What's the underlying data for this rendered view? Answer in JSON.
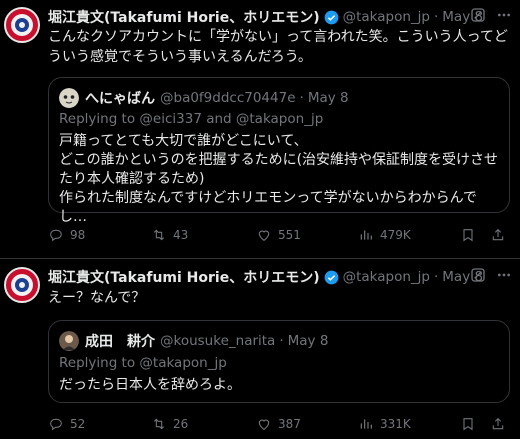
{
  "tweets": [
    {
      "name": "堀江貴文(Takafumi Horie、ホリエモン)",
      "handle": "@takapon_jp",
      "date": "May 8",
      "text": "こんなクソアカウントに「学がない」って言われた笑。こういう人ってどういう感覚でそういう事いえるんだろう。",
      "quote": {
        "name": "へにゃばん",
        "handle": "@ba0f9ddcc70447e",
        "date": "May 8",
        "replying_prefix": "Replying to",
        "replying_users": "@eici337 and @takapon_jp",
        "lines": [
          "戸籍ってとても大切で誰がどこにいて、",
          "どこの誰かというのを把握するために(治安維持や保証制度を受けさせ",
          "たり本人確認するため)",
          "作られた制度なんですけどホリエモンって学がないからわからんでし…"
        ]
      },
      "stats": {
        "replies": "98",
        "retweets": "43",
        "likes": "551",
        "views": "479K"
      }
    },
    {
      "name": "堀江貴文(Takafumi Horie、ホリエモン)",
      "handle": "@takapon_jp",
      "date": "May 8",
      "text": "えー？なんで？",
      "quote": {
        "name": "成田　耕介",
        "handle": "@kousuke_narita",
        "date": "May 8",
        "replying_prefix": "Replying to",
        "replying_users": "@takapon_jp",
        "lines": [
          "だったら日本人を辞めろよ。"
        ]
      },
      "stats": {
        "replies": "52",
        "retweets": "26",
        "likes": "387",
        "views": "331K"
      }
    }
  ],
  "colors": {
    "accent": "#1d9bf0",
    "muted": "#71767b",
    "border": "#2f3336"
  },
  "icons": [
    "verified-badge-icon",
    "grok-icon",
    "more-icon",
    "reply-icon",
    "retweet-icon",
    "like-icon",
    "views-icon",
    "bookmark-icon",
    "share-icon"
  ]
}
